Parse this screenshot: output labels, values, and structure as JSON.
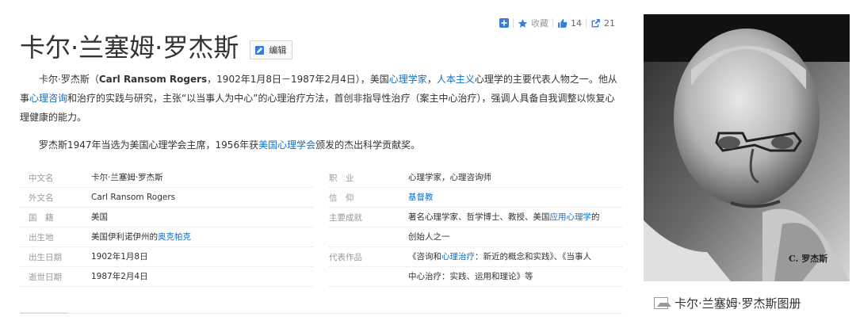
{
  "toolbar": {
    "add_icon": "plus-square-icon",
    "favorite_label": "收藏",
    "like_count": "14",
    "share_count": "21"
  },
  "title": "卡尔·兰塞姆·罗杰斯",
  "edit_label": "编辑",
  "summary": {
    "p1_prefix": "卡尔·罗杰斯（",
    "english_name": "Carl Ransom Rogers",
    "p1_a": "，1902年1月8日－1987年2月4日），美国",
    "link_psychologist": "心理学家",
    "p1_b": "，",
    "link_humanistic": "人本主义",
    "p1_c": "心理学的主要代表人物之一。他从事",
    "link_counseling": "心理咨询",
    "p1_d": "和治疗的实践与研究，主张“以当事人为中心”的心理治疗方法，首创非指导性治疗（案主中心治疗），强调人具备自我调整以恢复心理健康的能力。",
    "p2_a": "罗杰斯1947年当选为美国心理学会主席，1956年获",
    "link_apa": "美国心理学会",
    "p2_b": "颁发的杰出科学贡献奖。"
  },
  "basic_info": {
    "left": [
      {
        "k": "中文名",
        "v": "卡尔·兰塞姆·罗杰斯"
      },
      {
        "k": "外文名",
        "v": "Carl Ransom Rogers"
      },
      {
        "k": "国　籍",
        "v": "美国"
      },
      {
        "k": "出生地",
        "v_prefix": "美国伊利诺伊州的",
        "v_link": "奥克帕克"
      },
      {
        "k": "出生日期",
        "v": "1902年1月8日"
      },
      {
        "k": "逝世日期",
        "v": "1987年2月4日"
      }
    ],
    "right": {
      "job_k": "职　业",
      "job_v": "心理学家，心理咨询师",
      "faith_k": "信　仰",
      "faith_v": "基督教",
      "achv_k": "主要成就",
      "achv_v_a": "著名心理学家、哲学博士、教授、美国",
      "achv_v_link": "应用心理学",
      "achv_v_b": "的",
      "achv_v_line2": "创始人之一",
      "works_k": "代表作品",
      "works_v_a": "《咨询和",
      "works_v_link": "心理治疗",
      "works_v_b": "：新近的概念和实践》、《当事人",
      "works_v_line2": "中心治疗：实践、运用和理论》等"
    }
  },
  "photo_caption": "C. 罗杰斯",
  "album_label": "卡尔·兰塞姆·罗杰斯图册",
  "colors": {
    "link": "#136ec2",
    "toolbar_icon": "#3a7bd5"
  }
}
